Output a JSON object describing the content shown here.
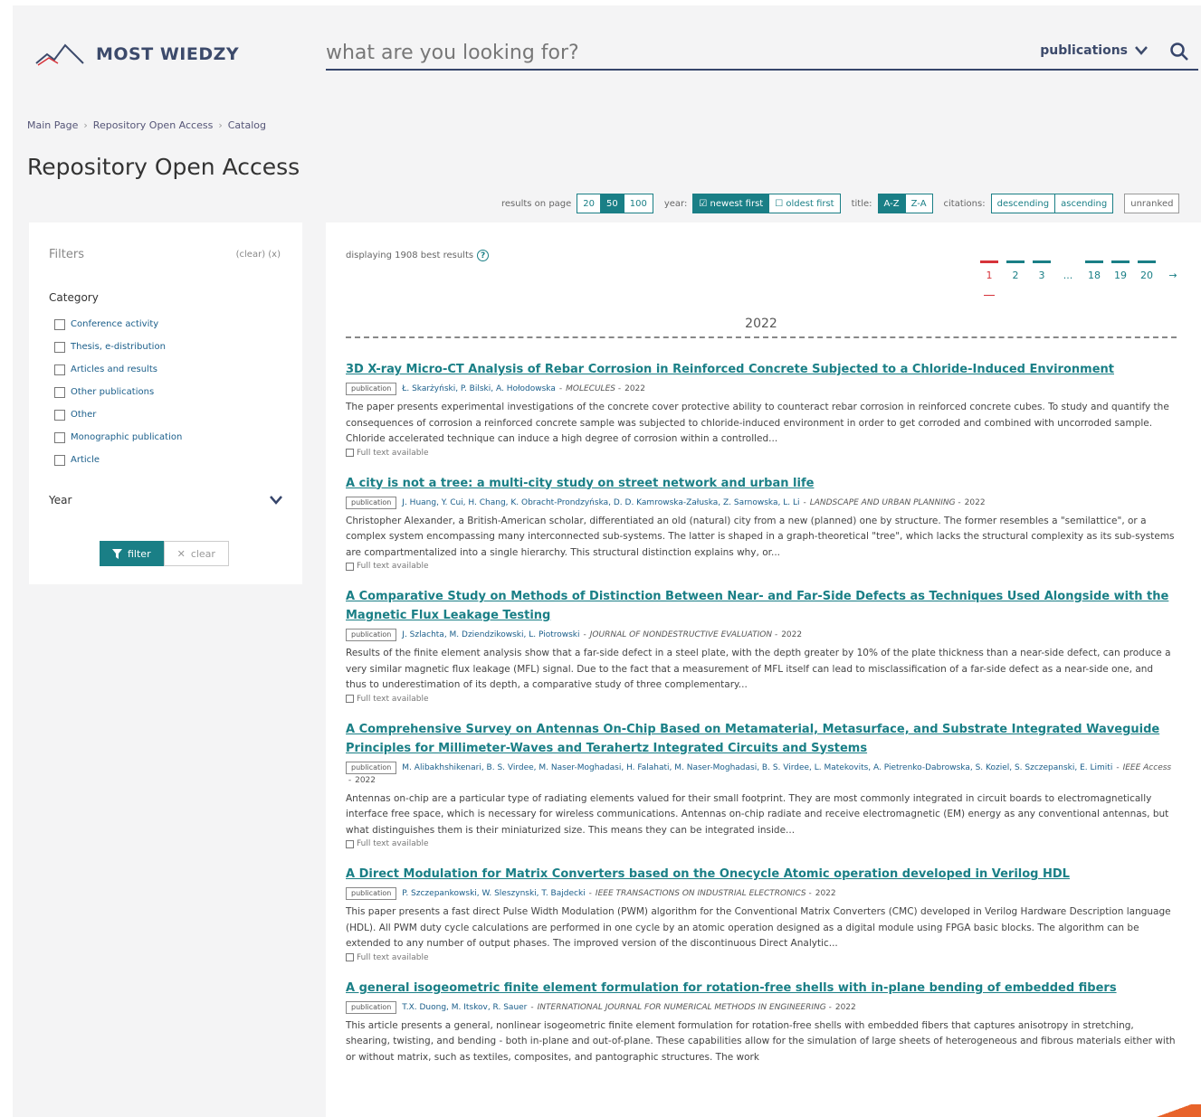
{
  "header": {
    "logo_text": "MOST WIEDZY",
    "search_placeholder": "what are you looking for?",
    "search_type": "publications"
  },
  "breadcrumb": [
    "Main Page",
    "Repository Open Access",
    "Catalog"
  ],
  "page_title": "Repository Open Access",
  "toolbar": {
    "results_label": "results on page",
    "results_options": [
      "20",
      "50",
      "100"
    ],
    "results_selected": "50",
    "year_label": "year:",
    "year_newest": "newest first",
    "year_oldest": "oldest first",
    "title_label": "title:",
    "title_az": "A-Z",
    "title_za": "Z-A",
    "citations_label": "citations:",
    "citations_desc": "descending",
    "citations_asc": "ascending",
    "unranked": "unranked"
  },
  "filters": {
    "title": "Filters",
    "clear_all": "(clear) (x)",
    "category_title": "Category",
    "categories": [
      {
        "label": "Conference activity"
      },
      {
        "label": "Thesis, e-distribution"
      },
      {
        "label": "Articles and results"
      },
      {
        "label": "Other publications"
      },
      {
        "label": "Other"
      },
      {
        "label": "Monographic publication"
      },
      {
        "label": "Article"
      }
    ],
    "year_title": "Year",
    "filter_button": "filter",
    "clear_button": "clear"
  },
  "results": {
    "displaying": "displaying 1908 best results",
    "pages": [
      "1",
      "2",
      "3",
      "...",
      "18",
      "19",
      "20"
    ],
    "current_page": "1",
    "next": "→",
    "year_heading": "2022",
    "items": [
      {
        "title": "3D X-ray Micro-CT Analysis of Rebar Corrosion in Reinforced Concrete Subjected to a Chloride-Induced Environment",
        "type": "publication",
        "authors": "Ł. Skarżyński, P. Bilski, A. Hołodowska",
        "journal": "MOLECULES",
        "year": "2022",
        "abstract": "The paper presents experimental investigations of the concrete cover protective ability to counteract rebar corrosion in reinforced concrete cubes. To study and quantify the consequences of corrosion a reinforced concrete sample was subjected to chloride-induced environment in order to get corroded and combined with uncorroded sample. Chloride accelerated technique can induce a high degree of corrosion within a controlled...",
        "fulltext": "Full text available"
      },
      {
        "title": "A city is not a tree: a multi-city study on street network and urban life",
        "type": "publication",
        "authors": "J. Huang, Y. Cui, H. Chang, K. Obracht-Prondzyńska, D. D. Kamrowska-Załuska, Z. Sarnowska, L. Li",
        "journal": "LANDSCAPE AND URBAN PLANNING",
        "year": "2022",
        "abstract": "Christopher Alexander, a British-American scholar, differentiated an old (natural) city from a new (planned) one by structure. The former resembles a \"semilattice\", or a complex system encompassing many interconnected sub-systems. The latter is shaped in a graph-theoretical \"tree\", which lacks the structural complexity as its sub-systems are compartmentalized into a single hierarchy. This structural distinction explains why, or...",
        "fulltext": "Full text available"
      },
      {
        "title": "A Comparative Study on Methods of Distinction Between Near- and Far-Side Defects as Techniques Used Alongside with the Magnetic Flux Leakage Testing",
        "type": "publication",
        "authors": "J. Szlachta, M. Dziendzikowski, L. Piotrowski",
        "journal": "JOURNAL OF NONDESTRUCTIVE EVALUATION",
        "year": "2022",
        "abstract": "Results of the finite element analysis show that a far-side defect in a steel plate, with the depth greater by 10% of the plate thickness than a near-side defect, can produce a very similar magnetic flux leakage (MFL) signal. Due to the fact that a measurement of MFL itself can lead to misclassification of a far-side defect as a near-side one, and thus to underestimation of its depth, a comparative study of three complementary...",
        "fulltext": "Full text available"
      },
      {
        "title": "A Comprehensive Survey on Antennas On-Chip Based on Metamaterial, Metasurface, and Substrate Integrated Waveguide Principles for Millimeter-Waves and Terahertz Integrated Circuits and Systems",
        "type": "publication",
        "authors": "M. Alibakhshikenari, B. S. Virdee, M. Naser-Moghadasi, H. Falahati, M. Naser-Moghadasi, B. S. Virdee, L. Matekovits, A. Pietrenko-Dabrowska, S. Koziel, S. Szczepanski, E. Limiti",
        "journal": "IEEE Access",
        "year": "2022",
        "abstract": "Antennas on-chip are a particular type of radiating elements valued for their small footprint. They are most commonly integrated in circuit boards to electromagnetically interface free space, which is necessary for wireless communications. Antennas on-chip radiate and receive electromagnetic (EM) energy as any conventional antennas, but what distinguishes them is their miniaturized size. This means they can be integrated inside...",
        "fulltext": "Full text available"
      },
      {
        "title": "A Direct Modulation for Matrix Converters based on the Onecycle Atomic operation developed in Verilog HDL",
        "type": "publication",
        "authors": "P. Szczepankowski, W. Sleszynski, T. Bajdecki",
        "journal": "IEEE TRANSACTIONS ON INDUSTRIAL ELECTRONICS",
        "year": "2022",
        "abstract": "This paper presents a fast direct Pulse Width Modulation (PWM) algorithm for the Conventional Matrix Converters (CMC) developed in Verilog Hardware Description language (HDL). All PWM duty cycle calculations are performed in one cycle by an atomic operation designed as a digital module using FPGA basic blocks. The algorithm can be extended to any number of output phases. The improved version of the discontinuous Direct Analytic...",
        "fulltext": "Full text available"
      },
      {
        "title": "A general isogeometric finite element formulation for rotation-free shells with in-plane bending of embedded fibers",
        "type": "publication",
        "authors": "T.X. Duong, M. Itskov, R. Sauer",
        "journal": "INTERNATIONAL JOURNAL FOR NUMERICAL METHODS IN ENGINEERING",
        "year": "2022",
        "abstract": "This article presents a general, nonlinear isogeometric finite element formulation for rotation-free shells with embedded fibers that captures anisotropy in stretching, shearing, twisting, and bending - both in-plane and out-of-plane. These capabilities allow for the simulation of large sheets of heterogeneous and fibrous materials either with or without matrix, such as textiles, composites, and pantographic structures. The work",
        "fulltext": ""
      }
    ]
  },
  "colors": {
    "accent": "#1a7f86",
    "navy": "#36456b",
    "current_page": "#d6333a"
  }
}
